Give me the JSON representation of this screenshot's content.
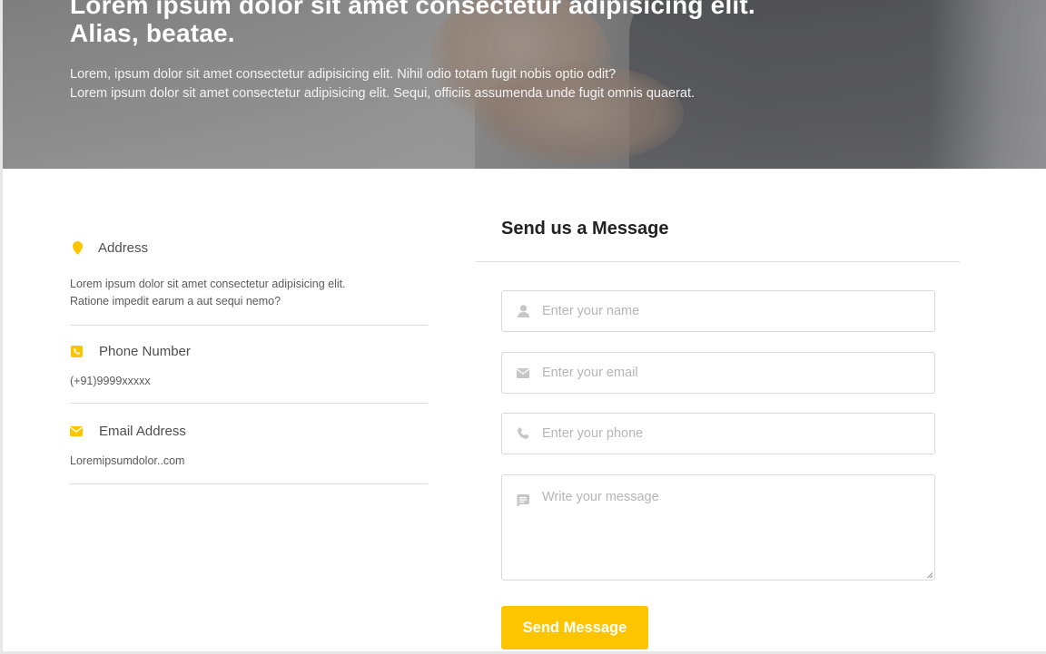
{
  "hero": {
    "title_line1": "Lorem ipsum dolor sit amet consectetur adipisicing elit.",
    "title_line2": "Alias, beatae.",
    "text_line1": "Lorem, ipsum dolor sit amet consectetur adipisicing elit. Nihil odio totam fugit nobis optio odit?",
    "text_line2": "Lorem ipsum dolor sit amet consectetur adipisicing elit. Sequi, officiis assumenda unde fugit omnis quaerat."
  },
  "contact": {
    "address": {
      "icon": "map-pin-icon",
      "title": "Address",
      "line1": "Lorem ipsum dolor sit amet consectetur adipisicing elit.",
      "line2": "Ratione impedit earum a aut sequi nemo?"
    },
    "phone": {
      "icon": "phone-square-icon",
      "title": "Phone Number",
      "value": "(+91)9999xxxxx"
    },
    "email": {
      "icon": "envelope-icon",
      "title": "Email Address",
      "value": "Loremipsumdolor..com"
    }
  },
  "form": {
    "title": "Send us a Message",
    "name_placeholder": "Enter your name",
    "email_placeholder": "Enter your email",
    "phone_placeholder": "Enter your phone",
    "message_placeholder": "Write your message",
    "submit_label": "Send Message"
  },
  "colors": {
    "accent": "#fdc500",
    "input_icon": "#c6c6c6"
  }
}
